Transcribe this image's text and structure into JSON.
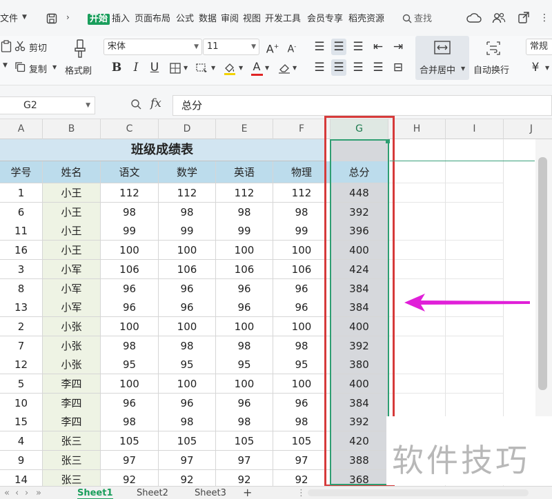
{
  "menubar": {
    "file": "文件",
    "tabs": [
      "开始",
      "插入",
      "页面布局",
      "公式",
      "数据",
      "审阅",
      "视图",
      "开发工具",
      "会员专享",
      "稻壳资源"
    ],
    "active_tab": "开始",
    "search": "查找"
  },
  "ribbon": {
    "cut": "剪切",
    "copy": "复制",
    "format_painter": "格式刷",
    "font_name": "宋体",
    "font_size": "11",
    "merge_center": "合并居中",
    "auto_wrap": "自动换行",
    "number_format": "常规",
    "currency": "¥"
  },
  "formula_bar": {
    "cell_ref": "G2",
    "fx": "fx",
    "content": "总分"
  },
  "columns": [
    "A",
    "B",
    "C",
    "D",
    "E",
    "F",
    "G",
    "H",
    "I",
    "J"
  ],
  "selected_column": "G",
  "table": {
    "title": "班级成绩表",
    "headers": [
      "学号",
      "姓名",
      "语文",
      "数学",
      "英语",
      "物理",
      "总分"
    ],
    "rows": [
      [
        "1",
        "小王",
        "112",
        "112",
        "112",
        "112",
        "448"
      ],
      [
        "6",
        "小王",
        "98",
        "98",
        "98",
        "98",
        "392"
      ],
      [
        "11",
        "小王",
        "99",
        "99",
        "99",
        "99",
        "396"
      ],
      [
        "16",
        "小王",
        "100",
        "100",
        "100",
        "100",
        "400"
      ],
      [
        "3",
        "小军",
        "106",
        "106",
        "106",
        "106",
        "424"
      ],
      [
        "8",
        "小军",
        "96",
        "96",
        "96",
        "96",
        "384"
      ],
      [
        "13",
        "小军",
        "96",
        "96",
        "96",
        "96",
        "384"
      ],
      [
        "2",
        "小张",
        "100",
        "100",
        "100",
        "100",
        "400"
      ],
      [
        "7",
        "小张",
        "98",
        "98",
        "98",
        "98",
        "392"
      ],
      [
        "12",
        "小张",
        "95",
        "95",
        "95",
        "95",
        "380"
      ],
      [
        "5",
        "李四",
        "100",
        "100",
        "100",
        "100",
        "400"
      ],
      [
        "10",
        "李四",
        "96",
        "96",
        "96",
        "96",
        "384"
      ],
      [
        "15",
        "李四",
        "98",
        "98",
        "98",
        "98",
        "392"
      ],
      [
        "4",
        "张三",
        "105",
        "105",
        "105",
        "105",
        "420"
      ],
      [
        "9",
        "张三",
        "97",
        "97",
        "97",
        "97",
        "388"
      ],
      [
        "14",
        "张三",
        "92",
        "92",
        "92",
        "92",
        "368"
      ]
    ]
  },
  "sheet_tabs": [
    "Sheet1",
    "Sheet2",
    "Sheet3"
  ],
  "active_sheet": "Sheet1",
  "add_sheet": "+",
  "watermark": "软件技巧",
  "colors": {
    "accent_green": "#1a9e5c",
    "selection_red": "#d63a3a",
    "arrow_magenta": "#e020d8",
    "header_blue": "#bcdcec",
    "title_blue": "#d2e5f1",
    "total_gray": "#d6d8dc"
  }
}
